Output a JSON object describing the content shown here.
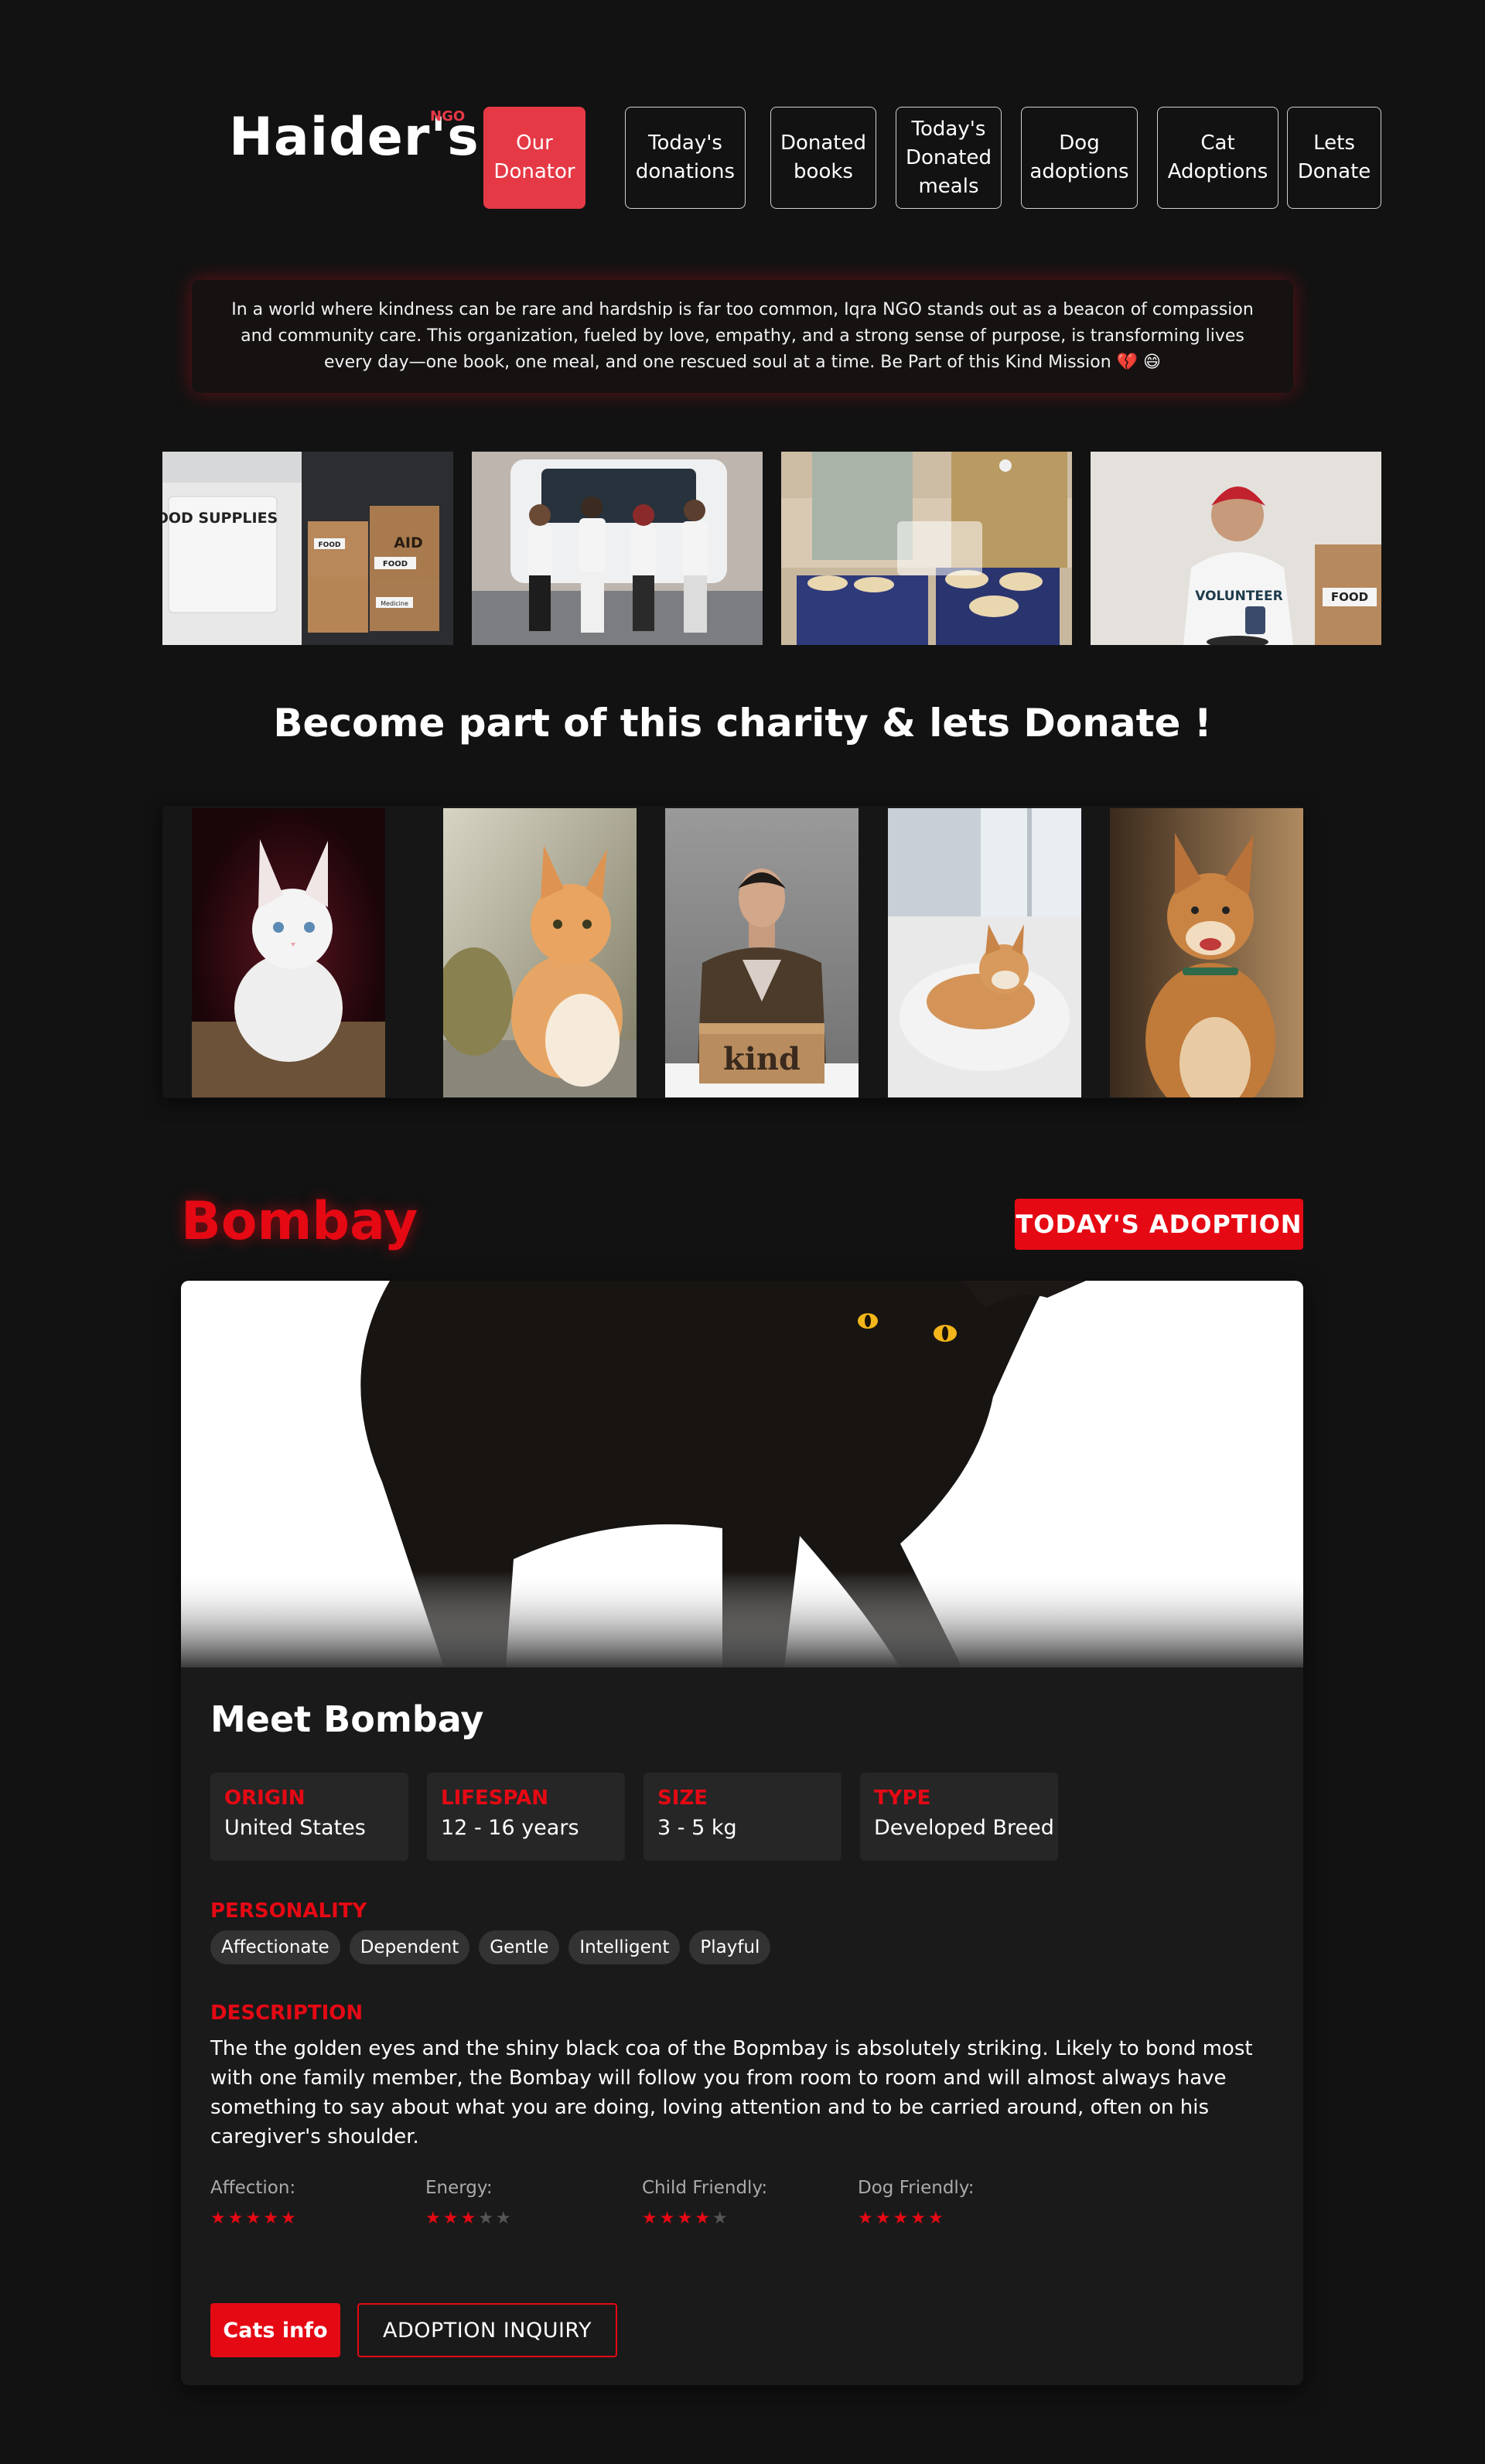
{
  "header": {
    "brand": "Haider's",
    "brand_badge": "NGO",
    "nav": [
      {
        "label": "Our Donator",
        "active": true
      },
      {
        "label": "Today's donations",
        "active": false
      },
      {
        "label": "Donated books",
        "active": false
      },
      {
        "label": "Today's Donated meals",
        "active": false
      },
      {
        "label": "Dog adoptions",
        "active": false
      },
      {
        "label": "Cat Adoptions",
        "active": false
      },
      {
        "label": "Lets Donate",
        "active": false
      }
    ]
  },
  "mission": {
    "text": "In a world where kindness can be rare and hardship is far too common, Iqra NGO stands out as a beacon of compassion and community care. This organization, fueled by love, empathy, and a strong sense of purpose, is transforming lives every day—one book, one meal, and one rescued soul at a time. Be Part of this Kind Mission 💔 😄"
  },
  "photo_strip": {
    "images": [
      "food-supplies-van-photo",
      "volunteers-group-photo",
      "food-packing-photo",
      "volunteer-serving-photo"
    ],
    "sign_text": "FOOD SUPPLIES",
    "box_labels": [
      "FOOD",
      "AID",
      "FOOD",
      "Medicine"
    ],
    "shirt_text": "VOLUNTEER",
    "crate_label": "FOOD"
  },
  "charity": {
    "heading": "Become part of this charity & lets Donate !",
    "gallery": [
      "white-kitten-photo",
      "orange-kitten-photo",
      "man-with-kind-box-photo",
      "shiba-lying-photo",
      "shiba-sitting-photo"
    ],
    "box_text": "kind"
  },
  "adoption": {
    "name": "Bombay",
    "badge": "TODAY'S ADOPTION",
    "title": "Meet Bombay",
    "facts": [
      {
        "label": "ORIGIN",
        "value": "United States"
      },
      {
        "label": "LIFESPAN",
        "value": "12 - 16 years"
      },
      {
        "label": "SIZE",
        "value": "3 - 5 kg"
      },
      {
        "label": "TYPE",
        "value": "Developed Breed"
      }
    ],
    "personality_label": "PERSONALITY",
    "personality": [
      "Affectionate",
      "Dependent",
      "Gentle",
      "Intelligent",
      "Playful"
    ],
    "description_label": "DESCRIPTION",
    "description": "The the golden eyes and the shiny black coa of the Bopmbay is absolutely striking. Likely to bond most with one family member, the Bombay will follow you from room to room and will almost always have something to say about what you are doing, loving attention and to be carried around, often on his caregiver's shoulder.",
    "ratings": [
      {
        "label": "Affection:",
        "value": 5,
        "max": 5
      },
      {
        "label": "Energy:",
        "value": 3,
        "max": 5
      },
      {
        "label": "Child Friendly:",
        "value": 4,
        "max": 5
      },
      {
        "label": "Dog Friendly:",
        "value": 5,
        "max": 5
      }
    ],
    "buttons": {
      "info": "Cats info",
      "inquiry": "ADOPTION INQUIRY"
    }
  },
  "colors": {
    "background": "#121212",
    "accent": "#e50914",
    "nav_active": "#e63946",
    "card": "#1a1a1a"
  }
}
